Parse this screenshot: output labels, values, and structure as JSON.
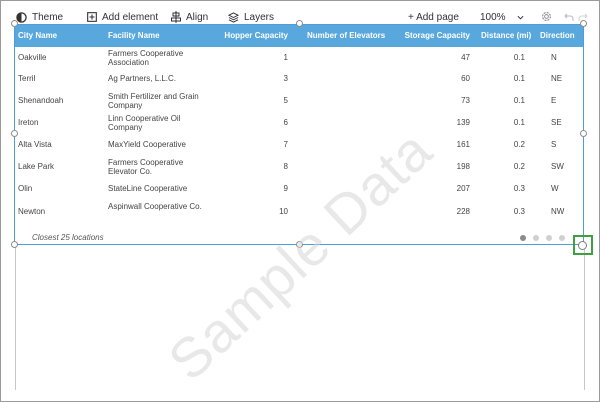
{
  "toolbar": {
    "theme": "Theme",
    "add_element": "Add element",
    "align": "Align",
    "layers": "Layers",
    "add_page": "+ Add page",
    "zoom": "100%"
  },
  "table": {
    "headers": {
      "city": "City Name",
      "facility": "Facility Name",
      "hopper": "Hopper Capacity",
      "elevators": "Number of Elevators",
      "storage": "Storage Capacity",
      "distance": "Distance (mi)",
      "direction": "Direction"
    },
    "rows": [
      {
        "city": "Oakville",
        "facility": "Farmers Cooperative Association",
        "hopper": "1",
        "elevators": "",
        "storage": "47",
        "distance": "0.1",
        "direction": "N"
      },
      {
        "city": "Terril",
        "facility": "Ag Partners, L.L.C.",
        "hopper": "3",
        "elevators": "",
        "storage": "60",
        "distance": "0.1",
        "direction": "NE"
      },
      {
        "city": "Shenandoah",
        "facility": "Smith Fertilizer and Grain Company",
        "hopper": "5",
        "elevators": "",
        "storage": "73",
        "distance": "0.1",
        "direction": "E"
      },
      {
        "city": "Ireton",
        "facility": "Linn Cooperative Oil Company",
        "hopper": "6",
        "elevators": "",
        "storage": "139",
        "distance": "0.1",
        "direction": "SE"
      },
      {
        "city": "Alta Vista",
        "facility": "MaxYield Cooperative",
        "hopper": "7",
        "elevators": "",
        "storage": "161",
        "distance": "0.2",
        "direction": "S"
      },
      {
        "city": "Lake Park",
        "facility": "Farmers Cooperative Elevator Co.",
        "hopper": "8",
        "elevators": "",
        "storage": "198",
        "distance": "0.2",
        "direction": "SW"
      },
      {
        "city": "Olin",
        "facility": "StateLine Cooperative",
        "hopper": "9",
        "elevators": "",
        "storage": "207",
        "distance": "0.3",
        "direction": "W"
      },
      {
        "city": "Newton",
        "facility": "Aspinwall Cooperative Co.",
        "hopper": "10",
        "elevators": "",
        "storage": "228",
        "distance": "0.3",
        "direction": "NW"
      }
    ],
    "footer": "Closest 25 locations",
    "pages": 4,
    "current_page": 1
  },
  "watermark": "Sample Data",
  "colors": {
    "header_bg": "#58a8dd",
    "widget_border": "#4a9fd8",
    "resize_highlight": "#3ea03e",
    "active_dot": "#8a8a8a",
    "inactive_dot": "#d0d0d0"
  }
}
